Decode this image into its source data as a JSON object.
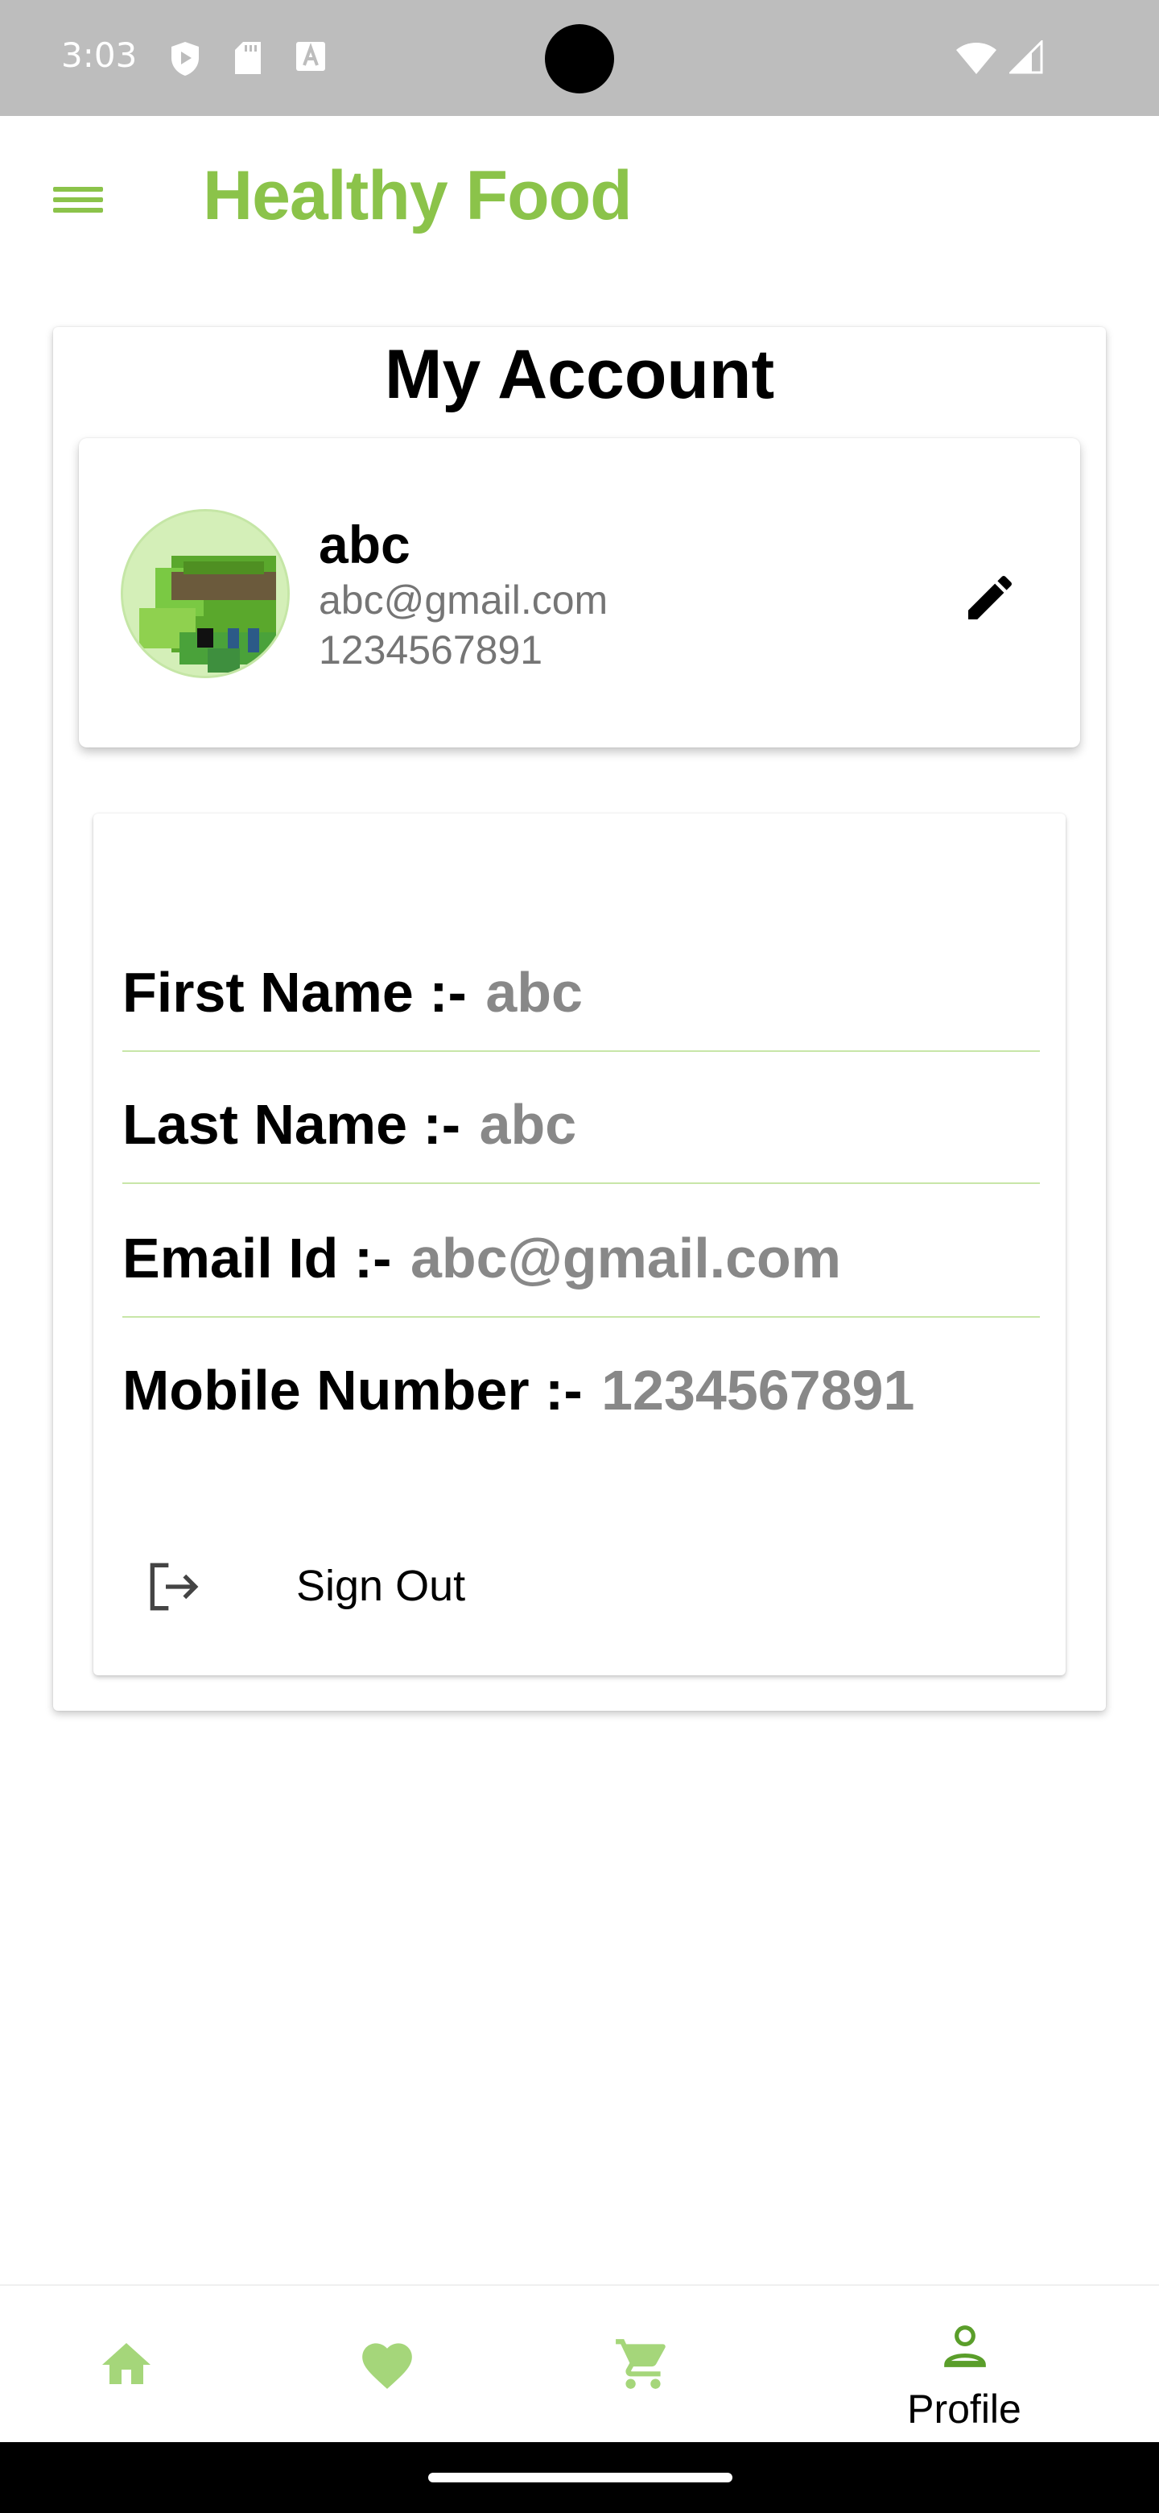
{
  "status_bar": {
    "time": "3:03",
    "icons": [
      "shield-play-icon",
      "sd-card-icon",
      "font-a-icon",
      "wifi-icon",
      "signal-icon"
    ]
  },
  "app_bar": {
    "title": "Healthy Food",
    "menu_icon": "hamburger-menu-icon",
    "accent_color": "#8bc34a"
  },
  "account": {
    "title": "My Account",
    "profile": {
      "name": "abc",
      "email": "abc@gmail.com",
      "phone": "1234567891",
      "edit_icon": "pencil-icon"
    },
    "details": [
      {
        "label": "First Name :-",
        "value": "abc"
      },
      {
        "label": "Last Name :-",
        "value": "abc"
      },
      {
        "label": "Email Id :-",
        "value": "abc@gmail.com"
      },
      {
        "label": "Mobile Number :-",
        "value": "1234567891"
      }
    ],
    "sign_out": {
      "label": "Sign Out",
      "icon": "logout-icon"
    }
  },
  "bottom_nav": {
    "items": [
      {
        "icon": "home-icon",
        "label": ""
      },
      {
        "icon": "heart-icon",
        "label": ""
      },
      {
        "icon": "cart-icon",
        "label": ""
      },
      {
        "icon": "person-icon",
        "label": "Profile",
        "active": true
      }
    ]
  }
}
